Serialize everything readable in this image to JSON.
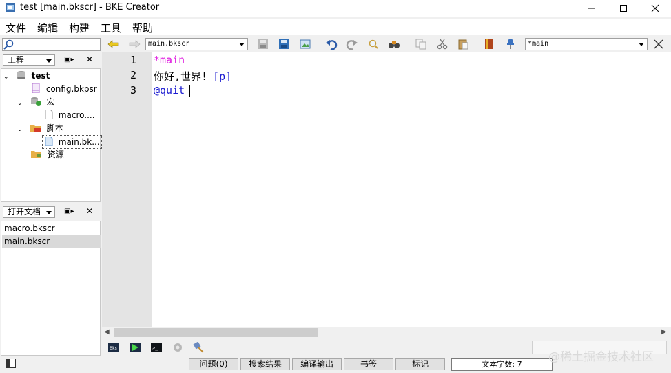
{
  "window": {
    "title": "test [main.bkscr] - BKE Creator"
  },
  "menu": [
    "文件",
    "编辑",
    "构建",
    "工具",
    "帮助"
  ],
  "toolbar": {
    "file_combo": "main.bkscr",
    "label_combo": "*main",
    "search_placeholder": ""
  },
  "project_panel": {
    "header": "工程",
    "tree": [
      {
        "label": "test",
        "bold": true
      },
      {
        "label": "config.bkpsr"
      },
      {
        "label": "宏"
      },
      {
        "label": "macro...."
      },
      {
        "label": "脚本"
      },
      {
        "label": "main.bk..."
      },
      {
        "label": "资源"
      }
    ]
  },
  "open_docs_panel": {
    "header": "打开文档",
    "items": [
      "macro.bkscr",
      "main.bkscr"
    ],
    "selected": 1
  },
  "editor": {
    "lines": [
      {
        "number": "1",
        "text": "*main",
        "color": "#e020e0"
      },
      {
        "number": "2",
        "text_a": "你好,世界!",
        "text_b": "[p]",
        "color_b": "#1a1ad0"
      },
      {
        "number": "3",
        "text": "@quit",
        "color": "#1a1ad0"
      }
    ]
  },
  "statusbar": {
    "tabs": [
      "问题(0)",
      "搜索结果",
      "编译输出",
      "书签",
      "标记"
    ],
    "char_count": "文本字数: 7"
  },
  "watermark": "@稀土掘金技术社区"
}
